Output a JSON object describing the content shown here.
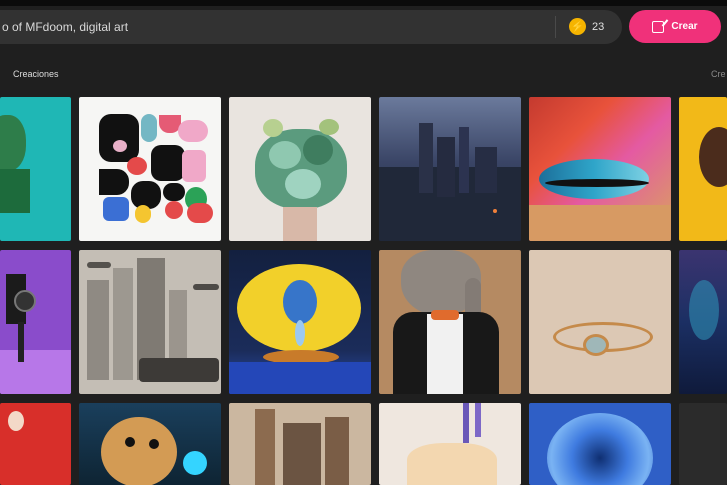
{
  "search": {
    "prompt": "o of MFdoom, digital art"
  },
  "credits": {
    "count": "23",
    "icon": "bolt-icon"
  },
  "create_button": {
    "label": "Crear",
    "icon": "pen-icon"
  },
  "gallery": {
    "title": "Creaciones",
    "link": "Cre",
    "accent": "#f0317a",
    "images": [
      "teal abstract collage",
      "colorful blob shapes on white",
      "succulent bouquet",
      "dark mountain fortress",
      "colorful eye makeup",
      "yellow partial tile",
      "retro camera on purple",
      "futuristic city with ships",
      "lemon with teardrop",
      "elephant in tuxedo",
      "gold ring on beige",
      "blue starry partial tile",
      "red partial tile",
      "fluffy cosmic creature",
      "ruined building painting",
      "glass with lavender",
      "blue flower macro",
      "dark partial tile"
    ]
  }
}
